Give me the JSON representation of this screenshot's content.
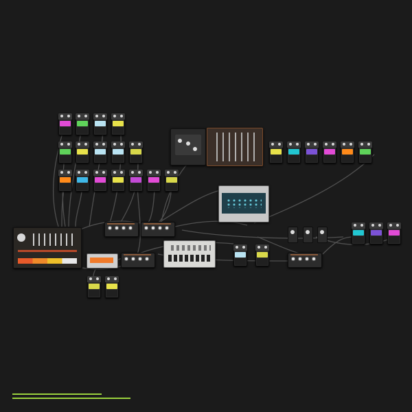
{
  "app": {
    "view": "modular-patch-canvas"
  },
  "colors": {
    "background": "#1b1b1b",
    "cable": "#555555",
    "accent_green": "#9bd33e",
    "pedal_colors": [
      "#e24bd6",
      "#5fd35a",
      "#b9e3f2",
      "#e8e24a",
      "#ff8a1a",
      "#3fb8e8",
      "#c34ad6",
      "#22c7d2",
      "#7b52d6",
      "#d8d84a"
    ]
  },
  "pedals": {
    "row1": [
      "#e24bd6",
      "#5fd35a",
      "#b9e3f2",
      "#e8e24a"
    ],
    "row2": [
      "#5fd35a",
      "#e8e24a",
      "#b9e3f2",
      "#b9e3f2",
      "#d8d84a"
    ],
    "row3": [
      "#ff8a1a",
      "#3fb8e8",
      "#e24bd6",
      "#e8e24a",
      "#c34ad6",
      "#e24bd6",
      "#d8d84a"
    ],
    "top_right": [
      "#e8e24a",
      "#22c7d2",
      "#7b52d6",
      "#e24bd6",
      "#ff8a1a",
      "#5fd35a"
    ],
    "bottom_left": [
      "#d8d84a",
      "#e8e24a"
    ],
    "right": [
      "#22c7d2",
      "#7b52d6",
      "#e24bd6"
    ],
    "center": [
      "#b9e3f2",
      "#d8d84a"
    ]
  },
  "icons": {
    "mixer": "mixer-icon",
    "drum_machine": "drum-machine-icon",
    "synth": "synth-icon",
    "sequencer": "tb303-icon",
    "sampler": "sampler-icon",
    "pedal": "pedal-icon"
  },
  "timeline": {
    "visible": true
  }
}
